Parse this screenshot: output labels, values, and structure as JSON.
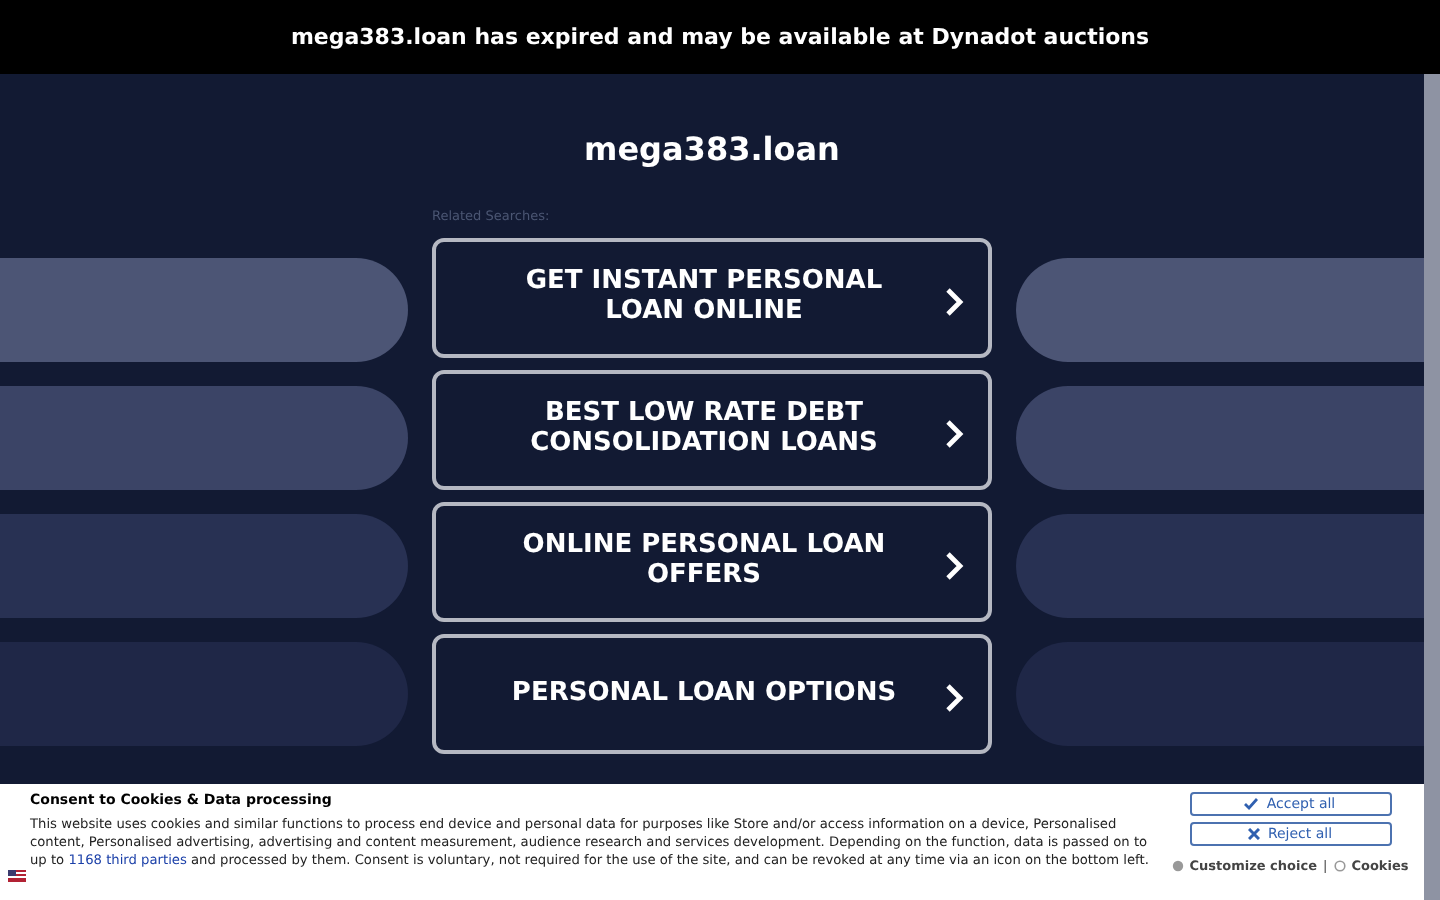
{
  "banner": {
    "text": "mega383.loan has expired and may be available at Dynadot auctions"
  },
  "domain": "mega383.loan",
  "related_label": "Related Searches:",
  "searches": [
    {
      "label": "GET INSTANT PERSONAL LOAN ONLINE"
    },
    {
      "label": "BEST LOW RATE DEBT CONSOLIDATION LOANS"
    },
    {
      "label": "ONLINE PERSONAL LOAN OFFERS"
    },
    {
      "label": "PERSONAL LOAN OPTIONS"
    }
  ],
  "consent": {
    "title": "Consent to Cookies & Data processing",
    "text_before": "This website uses cookies and similar functions to process end device and personal data for purposes like Store and/or access information on a device, Personalised content, Personalised advertising, advertising and content measurement, audience research and services development. Depending on the function, data is passed on to up to",
    "link": "1168 third parties",
    "text_after": "and processed by them. Consent is voluntary, not required for the use of the site, and can be revoked at any time via an icon on the bottom left.",
    "accept": "Accept all",
    "reject": "Reject all",
    "customize": "Customize choice",
    "separator": "|",
    "cookies": "Cookies"
  }
}
